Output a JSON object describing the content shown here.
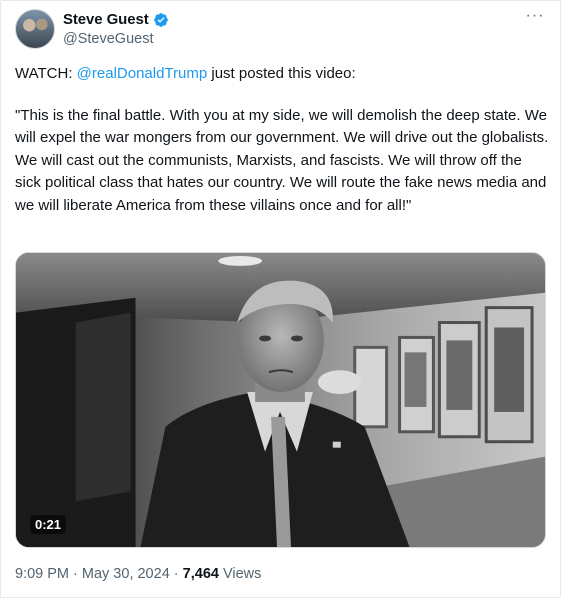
{
  "author": {
    "display_name": "Steve Guest",
    "handle": "@SteveGuest",
    "verified": true
  },
  "tweet": {
    "prefix": "WATCH: ",
    "mention": "@realDonaldTrump",
    "suffix": " just posted this video:",
    "quote": "\"This is the final battle. With you at my side, we will demolish the deep state. We will expel the war mongers from our government. We will drive out the globalists. We will cast out the communists, Marxists, and fascists. We will throw off the sick political class that hates our country. We will route the fake news media and we will liberate America from these villains once and for all!\""
  },
  "media": {
    "duration": "0:21"
  },
  "meta": {
    "time": "9:09 PM",
    "separator": " · ",
    "date": "May 30, 2024",
    "views_count": "7,464",
    "views_label": " Views"
  },
  "colors": {
    "link": "#1d9bf0",
    "verified": "#1d9bf0",
    "secondary_text": "#536471"
  },
  "icons": {
    "verified": "verified-badge-icon",
    "more": "more-options-icon"
  }
}
